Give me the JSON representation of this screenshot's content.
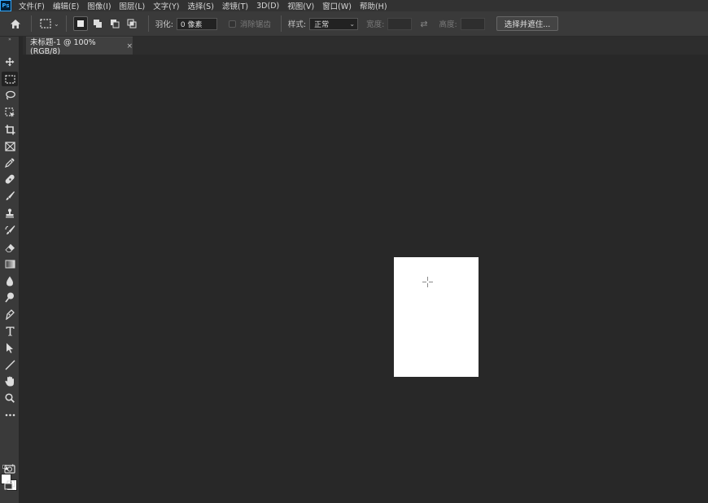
{
  "app": {
    "logo_text": "Ps"
  },
  "menu": [
    "文件(F)",
    "编辑(E)",
    "图像(I)",
    "图层(L)",
    "文字(Y)",
    "选择(S)",
    "滤镜(T)",
    "3D(D)",
    "视图(V)",
    "窗口(W)",
    "帮助(H)"
  ],
  "options": {
    "feather_label": "羽化:",
    "feather_value": "0 像素",
    "antialias_label": "消除锯齿",
    "style_label": "样式:",
    "style_value": "正常",
    "width_label": "宽度:",
    "height_label": "高度:",
    "select_mask_label": "选择并遮住..."
  },
  "document": {
    "tab_title": "未标题-1 @ 100%(RGB/8)",
    "close_glyph": "×",
    "canvas_color": "#ffffff"
  },
  "colors": {
    "foreground": "#ffffff",
    "background": "#ffffff",
    "workspace": "#282828",
    "panel": "#3a3a3a"
  },
  "tools": [
    "move-tool",
    "rectangular-marquee-tool",
    "lasso-tool",
    "object-selection-tool",
    "crop-tool",
    "frame-tool",
    "eyedropper-tool",
    "spot-healing-brush-tool",
    "brush-tool",
    "clone-stamp-tool",
    "history-brush-tool",
    "eraser-tool",
    "gradient-tool",
    "blur-tool",
    "dodge-tool",
    "pen-tool",
    "type-tool",
    "path-selection-tool",
    "line-tool",
    "hand-tool",
    "zoom-tool",
    "edit-toolbar"
  ]
}
